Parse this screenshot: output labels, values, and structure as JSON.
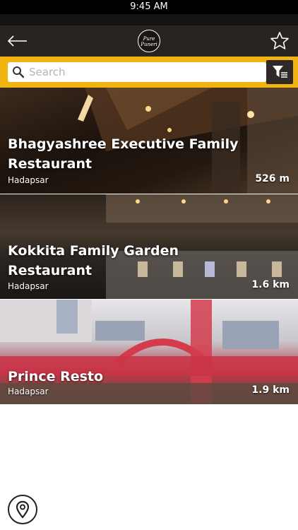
{
  "status_bar": {
    "time": "9:45 AM"
  },
  "header": {
    "logo_text": "Pure Puneri",
    "icons": {
      "back": "arrow-left-icon",
      "favorite": "star-outline-icon"
    }
  },
  "search": {
    "placeholder": "Search",
    "icon": "search-icon",
    "filter_icon": "filter-icon"
  },
  "restaurants": [
    {
      "name": "Bhagyashree Executive Family Restaurant",
      "area": "Hadapsar",
      "distance": "526 m"
    },
    {
      "name": "Kokkita Family Garden Restaurant",
      "area": "Hadapsar",
      "distance": "1.6 km"
    },
    {
      "name": "Prince Resto",
      "area": "Hadapsar",
      "distance": "1.9 km"
    }
  ],
  "footer": {
    "map_icon": "map-pin-icon"
  },
  "colors": {
    "accent": "#f2b411",
    "header_bg": "#2a2420",
    "text_light": "#ffffff"
  }
}
